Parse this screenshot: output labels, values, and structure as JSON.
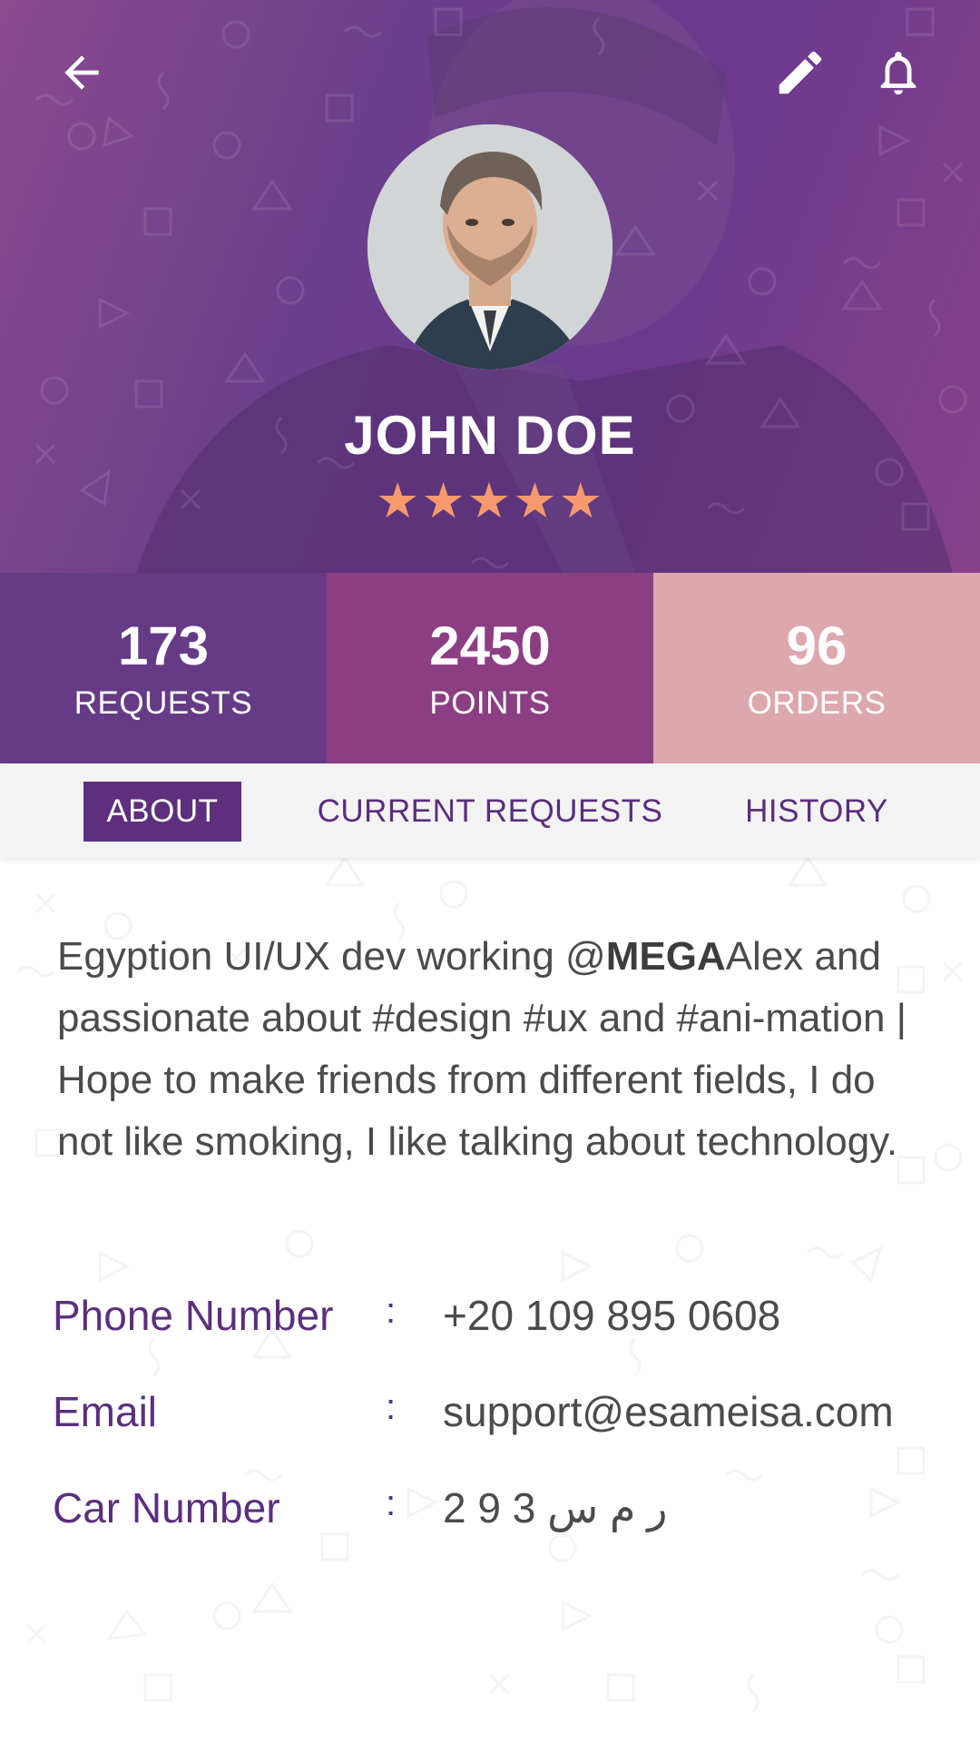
{
  "header": {
    "name": "JOHN DOE",
    "rating_stars": "★★★★★",
    "rating": 5,
    "rating_max": 5
  },
  "stats": [
    {
      "value": "173",
      "label": "REQUESTS"
    },
    {
      "value": "2450",
      "label": "POINTS"
    },
    {
      "value": "96",
      "label": "ORDERS"
    }
  ],
  "tabs": [
    {
      "label": "ABOUT",
      "active": true
    },
    {
      "label": "CURRENT REQUESTS",
      "active": false
    },
    {
      "label": "HISTORY",
      "active": false
    }
  ],
  "about": {
    "bio_part1": "Egyption UI/UX dev working @",
    "bio_bold": "MEGA",
    "bio_part2": "Alex and passionate about #design #ux and #ani-mation | Hope to make friends from different fields, I do not like smoking, I like talking about technology."
  },
  "info": [
    {
      "label": "Phone Number",
      "colon": ":",
      "value": "+20 109 895 0608"
    },
    {
      "label": "Email",
      "colon": ":",
      "value": "support@esameisa.com"
    },
    {
      "label": "Car Number",
      "colon": ":",
      "value": "2 9 3 ر م س"
    }
  ],
  "icons": {
    "back": "arrow-left-icon",
    "edit": "pencil-icon",
    "notifications": "bell-icon"
  },
  "colors": {
    "header_purple": "#6b3a8e",
    "requests_bg": "#663b85",
    "points_bg": "#8b3f82",
    "orders_bg": "#dca8ad",
    "accent_purple": "#5d2f7d",
    "star_color": "#f69a6e"
  }
}
